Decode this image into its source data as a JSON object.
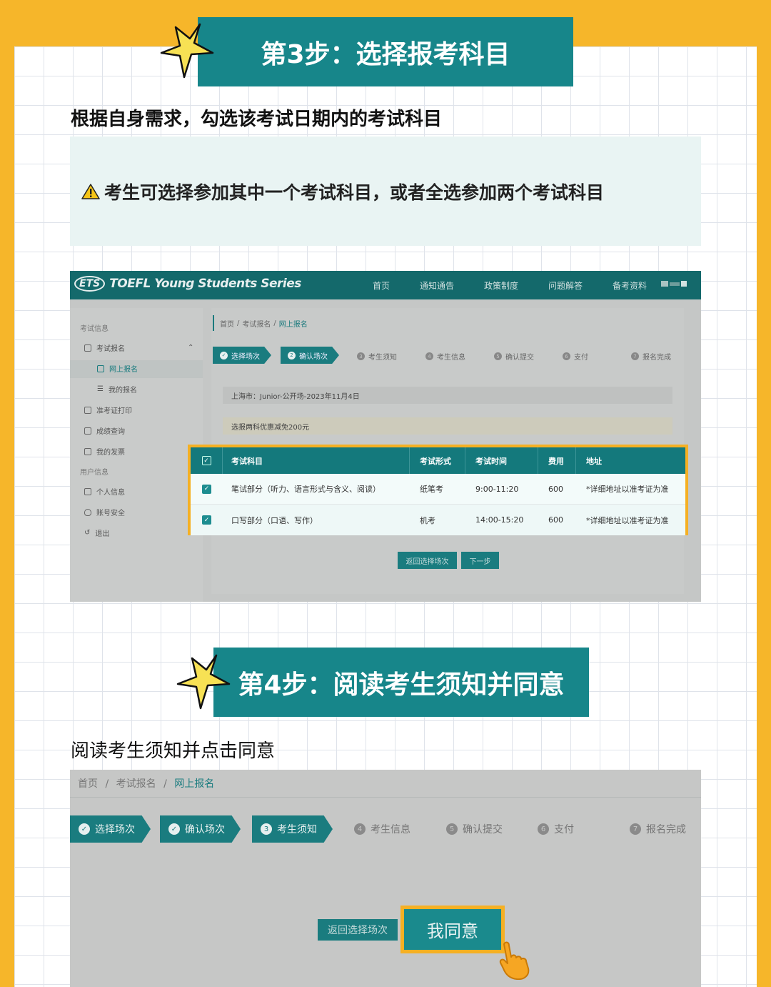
{
  "step3": {
    "title": "第3步：选择报考科目",
    "subtitle": "根据自身需求，勾选该考试日期内的考试科目",
    "notice": "考生可选择参加其中一个考试科目，或者全选参加两个考试科目",
    "notice_icon": "warning-icon"
  },
  "site": {
    "logo_ets": "ETS",
    "logo_text": "TOEFL Young Students Series",
    "nav": [
      "首页",
      "通知通告",
      "政策制度",
      "问题解答",
      "备考资料"
    ]
  },
  "sidebar": {
    "section1": "考试信息",
    "items": [
      "考试报名",
      "网上报名",
      "我的报名",
      "准考证打印",
      "成绩查询",
      "我的发票"
    ],
    "section2": "用户信息",
    "items2": [
      "个人信息",
      "账号安全",
      "退出"
    ]
  },
  "breadcrumb": {
    "home": "首页",
    "sep": "/",
    "parent": "考试报名",
    "current": "网上报名"
  },
  "steps": [
    "选择场次",
    "确认场次",
    "考生须知",
    "考生信息",
    "确认提交",
    "支付",
    "报名完成"
  ],
  "session": {
    "location": "上海市：",
    "name": "Junior-公开场-2023年11月4日",
    "discount": "选报两科优惠减免200元"
  },
  "table": {
    "headers": [
      "考试科目",
      "考试形式",
      "考试时间",
      "费用",
      "地址"
    ],
    "rows": [
      {
        "subject": "笔试部分（听力、语言形式与含义、阅读）",
        "format": "纸笔考",
        "time": "9:00-11:20",
        "fee": "600",
        "address": "*详细地址以准考证为准",
        "checked": true
      },
      {
        "subject": "口写部分（口语、写作）",
        "format": "机考",
        "time": "14:00-15:20",
        "fee": "600",
        "address": "*详细地址以准考证为准",
        "checked": true
      }
    ]
  },
  "buttons1": {
    "back": "返回选择场次",
    "next": "下一步"
  },
  "step4": {
    "title": "第4步：阅读考生须知并同意",
    "subtitle": "阅读考生须知并点击同意"
  },
  "buttons2": {
    "back": "返回选择场次",
    "agree": "我同意"
  },
  "colors": {
    "accent": "#1a7c7f",
    "highlight": "#f5b023",
    "background": "#f6b62a"
  }
}
